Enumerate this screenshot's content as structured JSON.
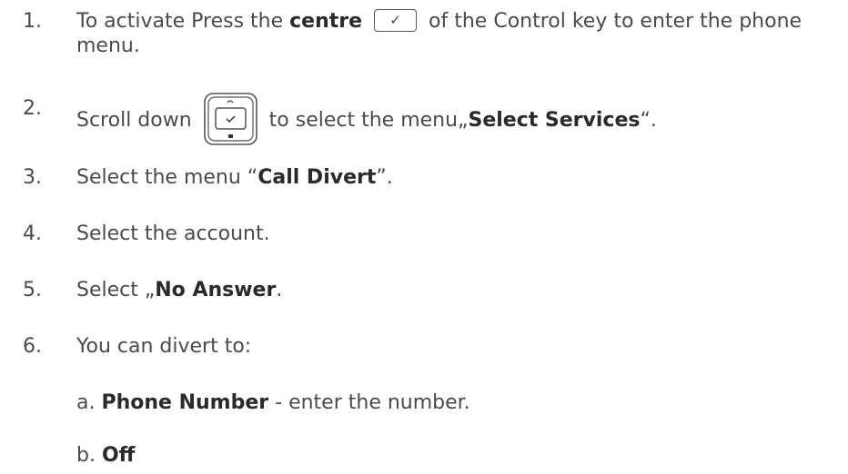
{
  "steps": [
    {
      "num": "1.",
      "parts": {
        "a": "To activate Press the ",
        "bold": "centre",
        "b": " of the Control key to enter the phone",
        "c": "menu."
      }
    },
    {
      "num": "2.",
      "parts": {
        "a": "Scroll down",
        "b": " to select the menu„",
        "bold": "Select Services",
        "c": "“."
      }
    },
    {
      "num": "3.",
      "parts": {
        "a": "Select the menu “",
        "bold": "Call Divert",
        "c": "”."
      }
    },
    {
      "num": "4.",
      "parts": {
        "a": "Select the account."
      }
    },
    {
      "num": "5.",
      "parts": {
        "a": "Select „",
        "bold": "No Answer",
        "c": "."
      }
    },
    {
      "num": "6.",
      "parts": {
        "a": "You can divert to:"
      }
    }
  ],
  "subitems": [
    {
      "prefix": "a. ",
      "bold": "Phone Number",
      "rest": " - enter the number."
    },
    {
      "prefix": "b. ",
      "bold": "Off",
      "rest": ""
    }
  ],
  "icons": {
    "check": "✓",
    "centre_key": "centre-key-icon",
    "nav_key": "navigation-key-icon"
  }
}
